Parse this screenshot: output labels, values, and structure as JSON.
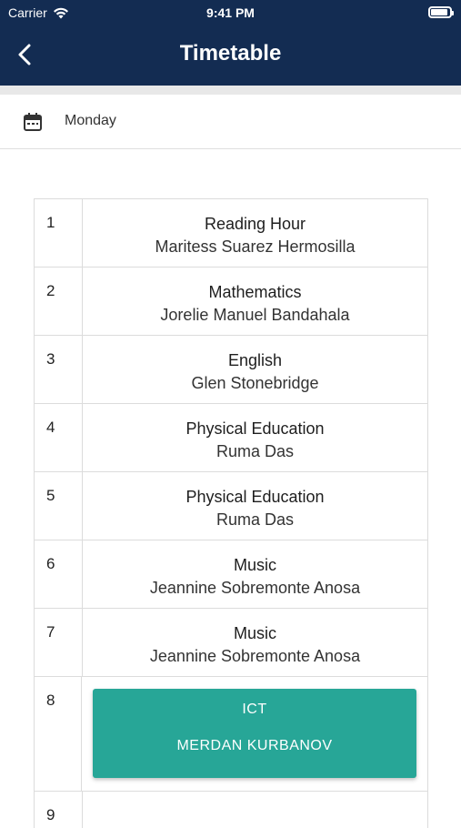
{
  "status_bar": {
    "carrier": "Carrier",
    "time": "9:41 PM"
  },
  "nav": {
    "title": "Timetable",
    "back_icon": "chevron-left-icon"
  },
  "day_selector": {
    "icon": "calendar-icon",
    "day": "Monday"
  },
  "timetable": {
    "rows": [
      {
        "period": "1",
        "subject": "Reading Hour",
        "teacher": "Maritess Suarez Hermosilla"
      },
      {
        "period": "2",
        "subject": "Mathematics",
        "teacher": "Jorelie Manuel Bandahala"
      },
      {
        "period": "3",
        "subject": "English",
        "teacher": "Glen Stonebridge"
      },
      {
        "period": "4",
        "subject": "Physical Education",
        "teacher": "Ruma Das"
      },
      {
        "period": "5",
        "subject": "Physical Education",
        "teacher": "Ruma Das"
      },
      {
        "period": "6",
        "subject": "Music",
        "teacher": "Jeannine Sobremonte Anosa"
      },
      {
        "period": "7",
        "subject": "Music",
        "teacher": "Jeannine Sobremonte Anosa"
      }
    ],
    "highlighted": {
      "period": "8",
      "subject": "ICT",
      "teacher": "MERDAN KURBANOV",
      "color": "#27a697"
    },
    "next_period": "9"
  },
  "colors": {
    "header": "#132c52",
    "accent": "#27a697"
  }
}
